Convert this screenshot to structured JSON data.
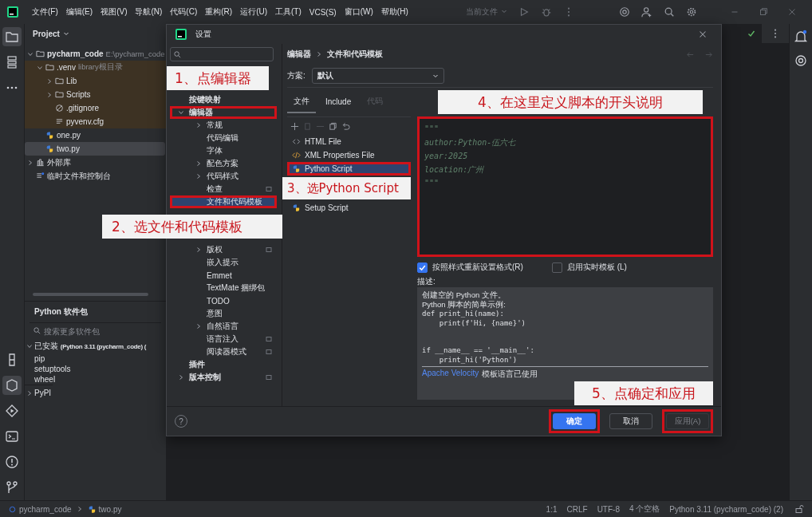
{
  "menu_bar": {
    "items": [
      "文件(F)",
      "编辑(E)",
      "视图(V)",
      "导航(N)",
      "代码(C)",
      "重构(R)",
      "运行(U)",
      "工具(T)",
      "VCS(S)",
      "窗口(W)",
      "帮助(H)"
    ],
    "run_config": "当前文件"
  },
  "project_panel": {
    "title": "Project",
    "tree": [
      {
        "name": "pycharm_code",
        "hint": "E:\\pycharm_code",
        "kind": "folder",
        "expanded": true,
        "selected": false,
        "children": [
          {
            "name": ".venv",
            "hint": "library根目录",
            "kind": "venv",
            "expanded": true,
            "selected": false,
            "children": [
              {
                "name": "Lib",
                "kind": "folder",
                "expanded": false,
                "selected": false
              },
              {
                "name": "Scripts",
                "kind": "folder",
                "expanded": false,
                "selected": false
              },
              {
                "name": ".gitignore",
                "kind": "ignore",
                "selected": false
              },
              {
                "name": "pyvenv.cfg",
                "kind": "text",
                "selected": false
              }
            ]
          },
          {
            "name": "one.py",
            "kind": "python",
            "selected": false
          },
          {
            "name": "two.py",
            "kind": "python",
            "selected": true
          }
        ]
      },
      {
        "name": "外部库",
        "kind": "library",
        "expanded": false,
        "selected": false
      },
      {
        "name": "临时文件和控制台",
        "kind": "scratch",
        "selected": false
      }
    ]
  },
  "packages_panel": {
    "title": "Python 软件包",
    "search_placeholder": "搜索更多软件包",
    "groups": [
      {
        "label": "已安装 **(Python 3.11 (pycharm_code) (**",
        "expanded": true,
        "packages": [
          "pip",
          "setuptools",
          "wheel"
        ]
      },
      {
        "label": "PyPI",
        "expanded": false
      }
    ]
  },
  "settings_dialog": {
    "title": "设置",
    "nav": [
      {
        "kind": "callout",
        "text": "1、点编辑器"
      },
      {
        "kind": "page",
        "label": "按键映射",
        "selected": false
      },
      {
        "kind": "page",
        "label": "编辑器",
        "expanded": true,
        "selected": false,
        "highlighted": true,
        "children": [
          {
            "kind": "page",
            "label": "常规",
            "expanded": false,
            "selected": false
          },
          {
            "kind": "page",
            "label": "代码编辑",
            "selected": false
          },
          {
            "kind": "page",
            "label": "字体",
            "selected": false
          },
          {
            "kind": "page",
            "label": "配色方案",
            "expanded": false,
            "selected": false
          },
          {
            "kind": "page",
            "label": "代码样式",
            "expanded": false,
            "selected": false
          },
          {
            "kind": "page",
            "label": "检查",
            "selected": false,
            "project_level": true
          },
          {
            "kind": "page",
            "label": "文件和代码模板",
            "selected": true,
            "highlighted": true
          },
          {
            "kind": "callout",
            "text": "2、选文件和代码模板"
          },
          {
            "kind": "page",
            "label": "版权",
            "expanded": false,
            "selected": false,
            "project_level": true
          },
          {
            "kind": "page",
            "label": "嵌入提示",
            "selected": false
          },
          {
            "kind": "page",
            "label": "Emmet",
            "selected": false
          },
          {
            "kind": "page",
            "label": "TextMate 捆绑包",
            "selected": false
          },
          {
            "kind": "page",
            "label": "TODO",
            "selected": false
          },
          {
            "kind": "page",
            "label": "意图",
            "selected": false
          },
          {
            "kind": "page",
            "label": "自然语言",
            "expanded": false,
            "selected": false
          },
          {
            "kind": "page",
            "label": "语言注入",
            "selected": false,
            "project_level": true
          },
          {
            "kind": "page",
            "label": "阅读器模式",
            "selected": false,
            "project_level": true
          }
        ]
      },
      {
        "kind": "page",
        "label": "插件",
        "selected": false
      },
      {
        "kind": "page",
        "label": "版本控制",
        "expanded": false,
        "selected": false,
        "project_level": true
      }
    ],
    "breadcrumb": [
      "编辑器",
      "文件和代码模板"
    ],
    "scheme": {
      "label": "方案:",
      "value": "默认"
    },
    "tabs": [
      {
        "label": "文件",
        "selected": true,
        "disabled": false
      },
      {
        "label": "Include",
        "selected": false,
        "disabled": false
      },
      {
        "label": "代码",
        "selected": false,
        "disabled": true
      }
    ],
    "tabs_callout": "4、在这里定义脚本的开头说明",
    "templates": [
      {
        "kind": "html",
        "name": "HTML File",
        "selected": false
      },
      {
        "kind": "xml",
        "name": "XML Properties File",
        "selected": false
      },
      {
        "kind": "python",
        "name": "Python Script",
        "selected": true,
        "highlighted": true
      },
      {
        "kind": "callout",
        "text": "3、选Python Script"
      },
      {
        "kind": "python",
        "name": "Setup Script",
        "selected": false
      }
    ],
    "editor": {
      "highlighted": true,
      "lines": [
        "\"\"\"",
        "author:Python-伍六七",
        "year:2025",
        "location:广州",
        "\"\"\""
      ]
    },
    "options": [
      {
        "label": "按照样式重新设置格式(R)",
        "checked": true
      },
      {
        "label": "启用实时模板 (L)",
        "checked": false
      }
    ],
    "description": {
      "label": "描述:",
      "intro": [
        "创建空的 Python 文件。",
        "Python 脚本的简单示例:"
      ],
      "code": "def print_hi(name):\n    print(f'Hi, {name}')\n\n\nif __name__ == '__main__':\n    print_hi('Python')",
      "footer_link": "Apache Velocity",
      "footer_text": "模板语言已使用"
    },
    "buttons": [
      {
        "label": "确定",
        "kind": "primary",
        "disabled": false,
        "highlighted": true
      },
      {
        "label": "取消",
        "kind": "secondary",
        "disabled": false
      },
      {
        "label": "应用(A)",
        "kind": "secondary",
        "disabled": true,
        "highlighted": true
      }
    ],
    "footer_callout": "5、点确定和应用",
    "help_label": "?"
  },
  "status_bar": {
    "path": [
      "pycharm_code",
      "two.py"
    ],
    "items": [
      "1:1",
      "CRLF",
      "UTF-8",
      "4 个空格",
      "Python 3.11 (pycharm_code) (2)"
    ]
  }
}
